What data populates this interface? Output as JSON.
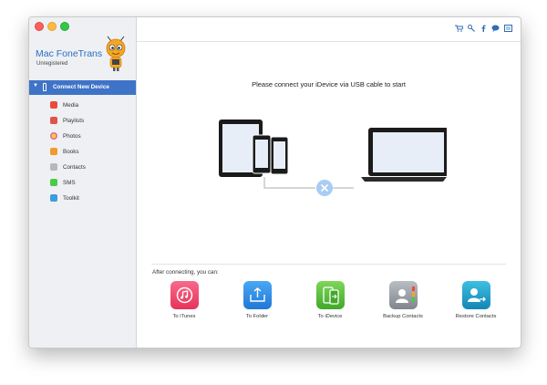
{
  "app": {
    "name": "Mac FoneTrans",
    "status": "Unregistered"
  },
  "sidebar": {
    "device_label": "Connect New Device",
    "items": [
      {
        "label": "Media",
        "icon": "music-icon",
        "color": "#ea4b3c"
      },
      {
        "label": "Playlists",
        "icon": "playlist-icon",
        "color": "#e0534a"
      },
      {
        "label": "Photos",
        "icon": "photos-icon",
        "color": "#f2a23a"
      },
      {
        "label": "Books",
        "icon": "book-icon",
        "color": "#f39a2c"
      },
      {
        "label": "Contacts",
        "icon": "contacts-icon",
        "color": "#9aa0a6"
      },
      {
        "label": "SMS",
        "icon": "sms-icon",
        "color": "#4cc94a"
      },
      {
        "label": "Toolkit",
        "icon": "toolkit-icon",
        "color": "#3d9be0"
      }
    ]
  },
  "toolbar": {
    "icons": [
      "cart-icon",
      "key-icon",
      "facebook-icon",
      "chat-icon",
      "menu-icon"
    ]
  },
  "main": {
    "prompt": "Please connect your iDevice via USB cable to start",
    "after_label": "After connecting, you can:",
    "actions": [
      {
        "label": "To iTunes",
        "icon": "itunes-icon",
        "color": "#f0436a"
      },
      {
        "label": "To Folder",
        "icon": "folder-export-icon",
        "color": "#2e8ee8"
      },
      {
        "label": "To iDevice",
        "icon": "idevice-transfer-icon",
        "color": "#5cc43a"
      },
      {
        "label": "Backup Contacts",
        "icon": "backup-contacts-icon",
        "color": "#8e959c"
      },
      {
        "label": "Restore Contacts",
        "icon": "restore-contacts-icon",
        "color": "#1fa3c9"
      }
    ]
  }
}
